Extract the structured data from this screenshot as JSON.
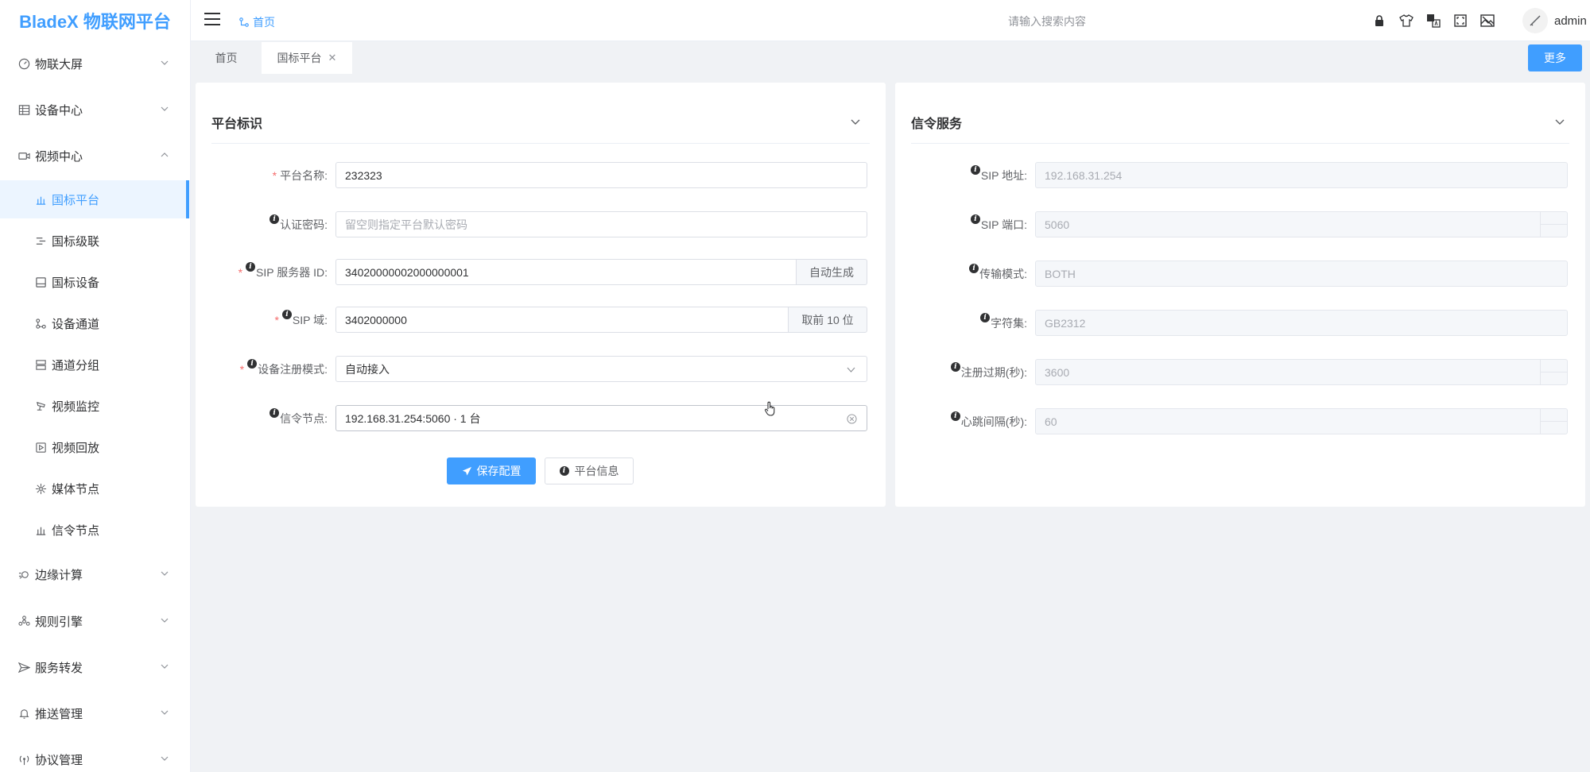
{
  "app": {
    "title": "BladeX 物联网平台"
  },
  "sidebar": {
    "menus": [
      {
        "label": "物联大屏",
        "icon": "dashboard-icon",
        "expanded": false
      },
      {
        "label": "设备中心",
        "icon": "table-icon",
        "expanded": false
      },
      {
        "label": "视频中心",
        "icon": "video-camera-icon",
        "expanded": true
      }
    ],
    "submenu": [
      {
        "label": "国标平台",
        "icon": "platform-icon",
        "active": true
      },
      {
        "label": "国标级联",
        "icon": "cascade-icon"
      },
      {
        "label": "国标设备",
        "icon": "device-icon"
      },
      {
        "label": "设备通道",
        "icon": "channel-icon"
      },
      {
        "label": "通道分组",
        "icon": "group-icon"
      },
      {
        "label": "视频监控",
        "icon": "monitor-icon"
      },
      {
        "label": "视频回放",
        "icon": "playback-icon"
      },
      {
        "label": "媒体节点",
        "icon": "media-node-icon"
      },
      {
        "label": "信令节点",
        "icon": "signal-node-icon"
      }
    ],
    "menus_after": [
      {
        "label": "边缘计算",
        "icon": "edge-compute-icon"
      },
      {
        "label": "规则引擎",
        "icon": "rule-engine-icon"
      },
      {
        "label": "服务转发",
        "icon": "send-icon"
      },
      {
        "label": "推送管理",
        "icon": "bell-icon"
      },
      {
        "label": "协议管理",
        "icon": "antenna-icon"
      }
    ]
  },
  "header": {
    "breadcrumb": "首页",
    "search_placeholder": "请输入搜索内容",
    "icons": [
      "lock-icon",
      "shirt-icon",
      "translate-icon",
      "fullscreen-icon",
      "image-icon"
    ],
    "username": "admin"
  },
  "tabs": [
    {
      "label": "首页",
      "active": false
    },
    {
      "label": "国标平台",
      "active": true,
      "closable": true
    }
  ],
  "more_label": "更多",
  "platform_card": {
    "title": "平台标识",
    "fields": {
      "name": {
        "label": "平台名称:",
        "value": "232323",
        "required": true
      },
      "password": {
        "label": "认证密码:",
        "placeholder": "留空则指定平台默认密码"
      },
      "sip_id": {
        "label": "SIP 服务器 ID:",
        "value": "34020000002000000001",
        "append": "自动生成",
        "required": true
      },
      "sip_domain": {
        "label": "SIP 域:",
        "value": "3402000000",
        "append": "取前 10 位",
        "required": true
      },
      "register_mode": {
        "label": "设备注册模式:",
        "value": "自动接入",
        "required": true
      },
      "signal_node": {
        "label": "信令节点:",
        "value": "192.168.31.254:5060 · 1 台"
      }
    },
    "save_label": "保存配置",
    "info_label": "平台信息"
  },
  "signal_card": {
    "title": "信令服务",
    "fields": {
      "sip_address": {
        "label": "SIP 地址:",
        "value": "192.168.31.254"
      },
      "sip_port": {
        "label": "SIP 端口:",
        "value": "5060"
      },
      "transport": {
        "label": "传输模式:",
        "value": "BOTH"
      },
      "charset": {
        "label": "字符集:",
        "value": "GB2312"
      },
      "register_expire": {
        "label": "注册过期(秒):",
        "value": "3600"
      },
      "heartbeat": {
        "label": "心跳间隔(秒):",
        "value": "60"
      }
    }
  },
  "colors": {
    "primary": "#409eff",
    "required": "#f56c6c",
    "background": "#f0f2f5"
  }
}
